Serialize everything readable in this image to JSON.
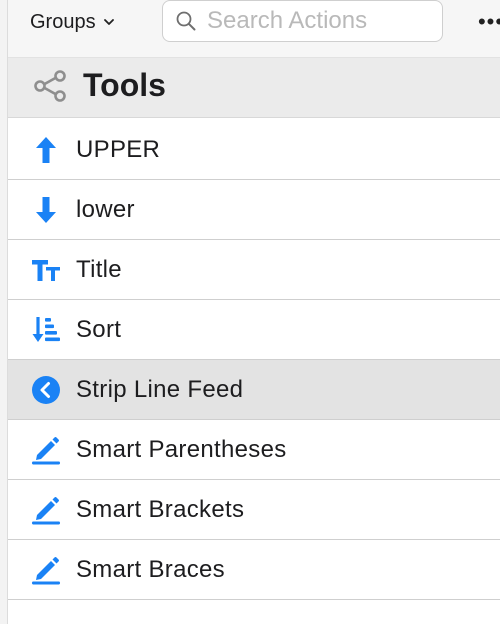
{
  "toolbar": {
    "groups_label": "Groups",
    "search_placeholder": "Search Actions",
    "search_value": "",
    "more_label": "•••"
  },
  "section": {
    "title": "Tools",
    "icon": "share-icon"
  },
  "colors": {
    "accent": "#1a82f5",
    "selected_row": "#e3e3e3"
  },
  "items": [
    {
      "label": "UPPER",
      "icon": "arrow-up-icon",
      "selected": false
    },
    {
      "label": "lower",
      "icon": "arrow-down-icon",
      "selected": false
    },
    {
      "label": "Title",
      "icon": "text-size-icon",
      "selected": false
    },
    {
      "label": "Sort",
      "icon": "sort-icon",
      "selected": false
    },
    {
      "label": "Strip Line Feed",
      "icon": "chevron-left-circle-icon",
      "selected": true
    },
    {
      "label": "Smart Parentheses",
      "icon": "pencil-underline-icon",
      "selected": false
    },
    {
      "label": "Smart Brackets",
      "icon": "pencil-underline-icon",
      "selected": false
    },
    {
      "label": "Smart Braces",
      "icon": "pencil-underline-icon",
      "selected": false
    }
  ]
}
